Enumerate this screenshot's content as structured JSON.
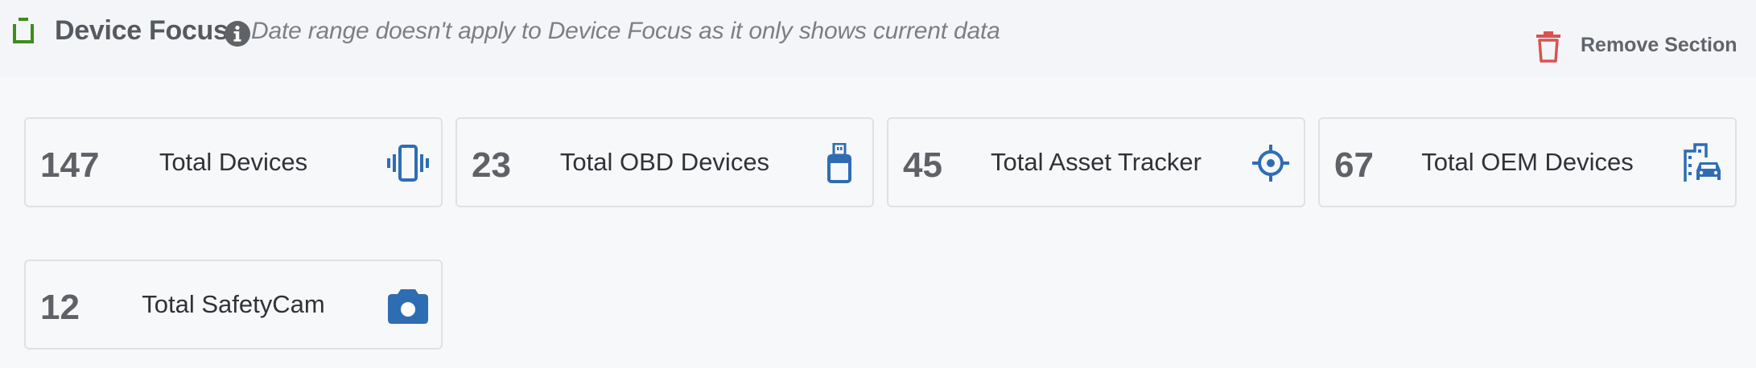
{
  "section": {
    "title": "Device Focus",
    "note": "Date range doesn't apply to Device Focus as it only shows current data",
    "remove_label": "Remove Section",
    "colors": {
      "accent_green": "#3e8d1c",
      "danger_red": "#d9534f",
      "icon_blue": "#2f6db3"
    }
  },
  "cards": [
    {
      "value": "147",
      "label": "Total Devices",
      "icon": "vibrating-phone-icon"
    },
    {
      "value": "23",
      "label": "Total OBD Devices",
      "icon": "usb-dongle-icon"
    },
    {
      "value": "45",
      "label": "Total Asset Tracker",
      "icon": "crosshair-icon"
    },
    {
      "value": "67",
      "label": "Total OEM Devices",
      "icon": "building-car-icon"
    },
    {
      "value": "12",
      "label": "Total SafetyCam",
      "icon": "camera-icon"
    }
  ]
}
